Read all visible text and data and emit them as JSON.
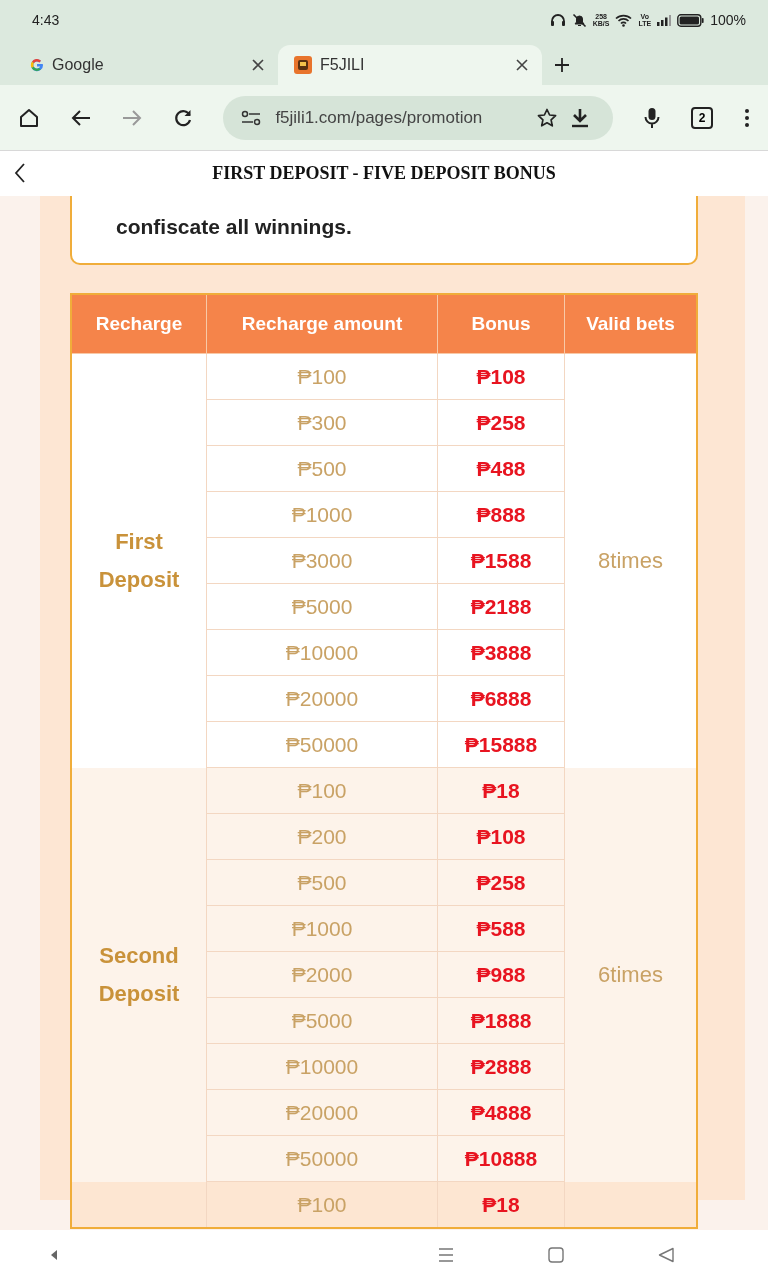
{
  "status_bar": {
    "time": "4:43",
    "speed": [
      "258",
      "KB/S"
    ],
    "volte": [
      "Vo",
      "LTE"
    ],
    "battery": "100%"
  },
  "tabs": [
    {
      "title": "Google",
      "selected": false,
      "kind": "google"
    },
    {
      "title": "F5JILI",
      "selected": true,
      "kind": "site"
    }
  ],
  "toolbar": {
    "url": "f5jili1.com/pages/promotion",
    "tab_count": "2"
  },
  "page": {
    "title": "FIRST DEPOSIT - FIVE DEPOSIT BONUS"
  },
  "notice": {
    "text": "confiscate all winnings."
  },
  "table": {
    "columns": [
      "Recharge",
      "Recharge amount",
      "Bonus",
      "Valid bets"
    ],
    "groups": [
      {
        "label": [
          "First",
          "Deposit"
        ],
        "valid_bets": "8times",
        "color": "#ffffff",
        "rows": [
          {
            "amount": "₱100",
            "bonus": "₱108"
          },
          {
            "amount": "₱300",
            "bonus": "₱258"
          },
          {
            "amount": "₱500",
            "bonus": "₱488"
          },
          {
            "amount": "₱1000",
            "bonus": "₱888"
          },
          {
            "amount": "₱3000",
            "bonus": "₱1588"
          },
          {
            "amount": "₱5000",
            "bonus": "₱2188"
          },
          {
            "amount": "₱10000",
            "bonus": "₱3888"
          },
          {
            "amount": "₱20000",
            "bonus": "₱6888"
          },
          {
            "amount": "₱50000",
            "bonus": "₱15888"
          }
        ]
      },
      {
        "label": [
          "Second",
          "Deposit"
        ],
        "valid_bets": "6times",
        "color": "#fdf3ea",
        "rows": [
          {
            "amount": "₱100",
            "bonus": "₱18"
          },
          {
            "amount": "₱200",
            "bonus": "₱108"
          },
          {
            "amount": "₱500",
            "bonus": "₱258"
          },
          {
            "amount": "₱1000",
            "bonus": "₱588"
          },
          {
            "amount": "₱2000",
            "bonus": "₱988"
          },
          {
            "amount": "₱5000",
            "bonus": "₱1888"
          },
          {
            "amount": "₱10000",
            "bonus": "₱2888"
          },
          {
            "amount": "₱20000",
            "bonus": "₱4888"
          },
          {
            "amount": "₱50000",
            "bonus": "₱10888"
          }
        ]
      },
      {
        "color": "#fde6d2",
        "rows": [
          {
            "amount": "₱100",
            "bonus": "₱18"
          }
        ]
      }
    ]
  }
}
